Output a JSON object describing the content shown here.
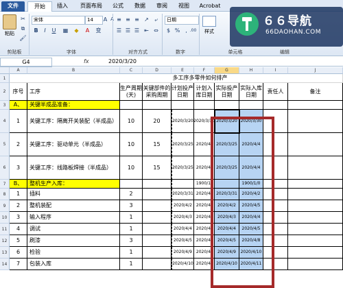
{
  "tabs": [
    "文件",
    "开始",
    "插入",
    "页面布局",
    "公式",
    "数据",
    "审阅",
    "视图",
    "Acrobat"
  ],
  "ribbon": {
    "paste_label": "粘贴",
    "clipboard_label": "剪贴板",
    "font_name": "宋体",
    "font_size": "14",
    "font_group_label": "字体",
    "align_group_label": "对齐方式",
    "number_format": "日期",
    "number_group_label": "数字",
    "style_label": "样式",
    "cells_group_label": "单元格",
    "edit_group_label": "编辑"
  },
  "logo": {
    "main": "６６导航",
    "sub": "66DAOHAN.COM"
  },
  "formula_bar": {
    "name_box": "G4",
    "fx": "fx",
    "value": "2020/3/20"
  },
  "sheet": {
    "columns": [
      "A",
      "B",
      "C",
      "D",
      "E",
      "F",
      "G",
      "H",
      "I",
      "J"
    ],
    "selected_column": "G",
    "title": "多工序多零件如何排产",
    "headers": [
      "序号",
      "工序",
      "生产周期(天)",
      "关键部件的采购周期",
      "计划投产日期",
      "计划入库日期",
      "实际投产日期",
      "实际入库日期",
      "责任人",
      "备注"
    ],
    "rows": [
      {
        "num": "1",
        "cells": [
          "",
          "",
          "",
          "",
          "",
          "",
          "",
          "",
          "",
          ""
        ]
      },
      {
        "num": "2",
        "cells": [
          "序号",
          "工序",
          "生产周期(天)",
          "关键部件的采购周期",
          "计划投产日期",
          "计划入库日期",
          "实际投产日期",
          "实际入库日期",
          "责任人",
          "备注"
        ]
      },
      {
        "num": "3",
        "cells": [
          "A、",
          "关键半成品准备：",
          "",
          "",
          "",
          "",
          "",
          "",
          "",
          ""
        ]
      },
      {
        "num": "4",
        "cells": [
          "1",
          "关键工序：隔离开关装配（半成品）",
          "10",
          "20",
          "2020/3/20",
          "2020/3/30",
          "2020/3/20",
          "2020/3/30",
          "",
          ""
        ]
      },
      {
        "num": "5",
        "cells": [
          "2",
          "关键工序：驱动单元（半成品）",
          "10",
          "15",
          "2020/3/25",
          "2020/4/",
          "2020/3/25",
          "2020/4/4",
          "",
          ""
        ]
      },
      {
        "num": "6",
        "cells": [
          "3",
          "关键工序：线路板焊接（半成品）",
          "10",
          "15",
          "2020/3/25",
          "2020/4/",
          "2020/3/25",
          "2020/4/4",
          "",
          ""
        ]
      },
      {
        "num": "7",
        "cells": [
          "B、",
          "整机生产入库：",
          "",
          "",
          "",
          "1900/1/",
          "",
          "1900/1/0",
          "",
          ""
        ]
      },
      {
        "num": "8",
        "cells": [
          "1",
          "插料",
          "2",
          "",
          "2020/3/31",
          "2020/4/",
          "2020/3/31",
          "2020/4/2",
          "",
          ""
        ]
      },
      {
        "num": "9",
        "cells": [
          "2",
          "整机装配",
          "3",
          "",
          "2020/4/2",
          "2020/4/",
          "2020/4/2",
          "2020/4/5",
          "",
          ""
        ]
      },
      {
        "num": "10",
        "cells": [
          "3",
          "输入程序",
          "1",
          "",
          "2020/4/3",
          "2020/4/",
          "2020/4/3",
          "2020/4/4",
          "",
          ""
        ]
      },
      {
        "num": "11",
        "cells": [
          "4",
          "调试",
          "1",
          "",
          "2020/4/4",
          "2020/4/",
          "2020/4/4",
          "2020/4/5",
          "",
          ""
        ]
      },
      {
        "num": "12",
        "cells": [
          "5",
          "刷漆",
          "3",
          "",
          "2020/4/5",
          "2020/4/",
          "2020/4/5",
          "2020/4/8",
          "",
          ""
        ]
      },
      {
        "num": "13",
        "cells": [
          "6",
          "检验",
          "1",
          "",
          "2020/4/9",
          "2020/4/",
          "2020/4/9",
          "2020/4/10",
          "",
          ""
        ]
      },
      {
        "num": "14",
        "cells": [
          "7",
          "包装入库",
          "1",
          "",
          "2020/4/10",
          "2020/4/",
          "2020/4/10",
          "2020/4/11",
          "",
          ""
        ]
      }
    ]
  },
  "colors": {
    "highlight": "#ffff00",
    "selection": "#b7d4f3",
    "annotation": "#a52a2a"
  }
}
